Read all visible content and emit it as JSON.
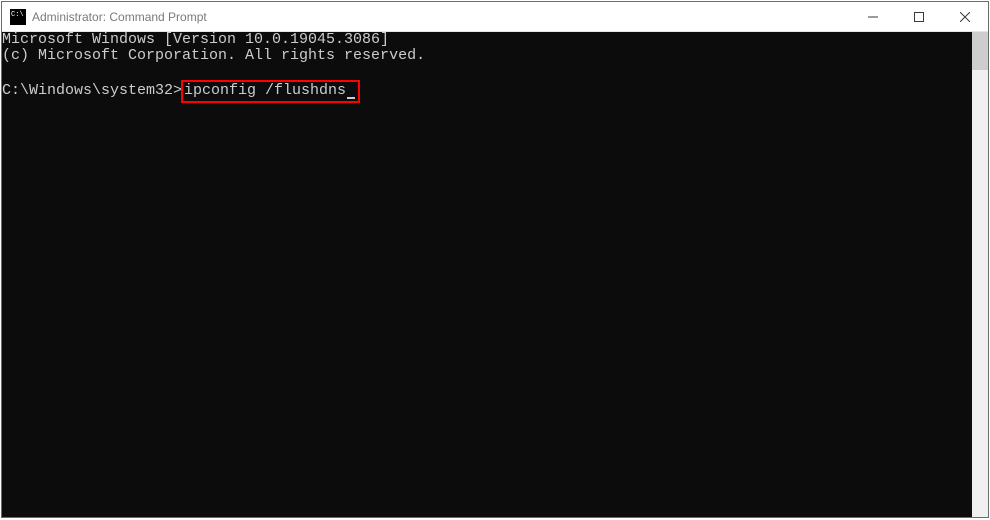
{
  "window": {
    "title": "Administrator: Command Prompt"
  },
  "terminal": {
    "line1": "Microsoft Windows [Version 10.0.19045.3086]",
    "line2": "(c) Microsoft Corporation. All rights reserved.",
    "prompt": "C:\\Windows\\system32>",
    "command": "ipconfig /flushdns"
  }
}
